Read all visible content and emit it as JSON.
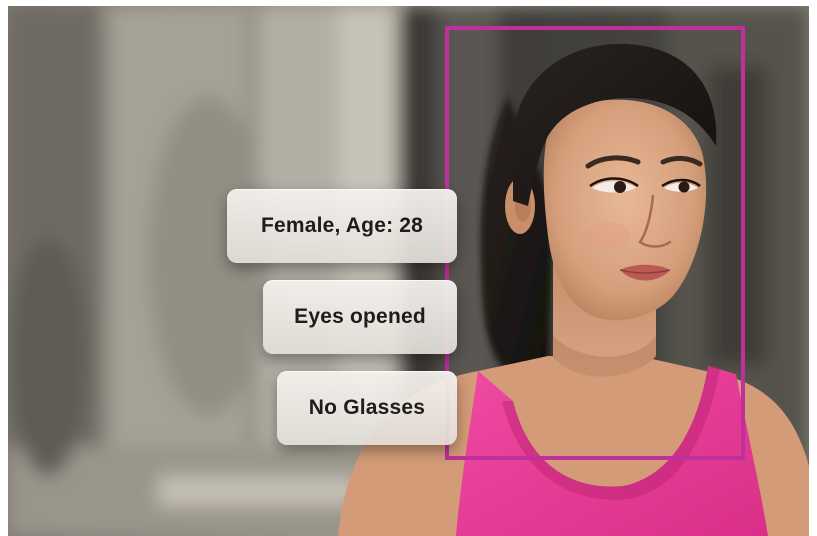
{
  "annotations": {
    "gender_age": "Female, Age: 28",
    "eyes": "Eyes opened",
    "glasses": "No Glasses"
  },
  "colors": {
    "detection_box": "#c0309a",
    "tag_background": "#e8e5e0",
    "tag_text": "#1d1d1d"
  }
}
